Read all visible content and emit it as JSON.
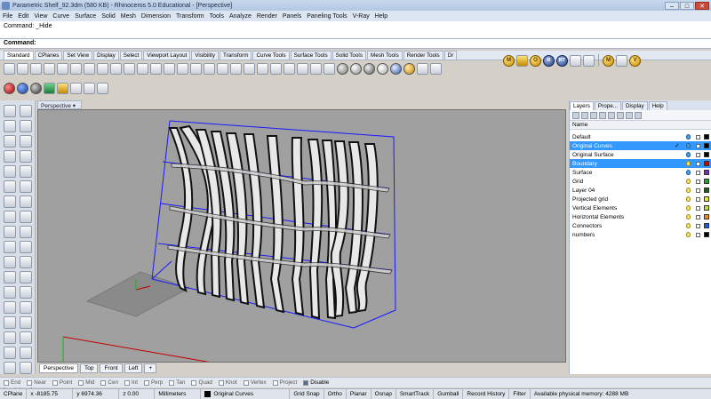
{
  "window": {
    "title": "Parametric Shelf_92.3dm (580 KB) - Rhinoceros 5.0 Educational - [Perspective]",
    "controls": [
      "–",
      "□",
      "✕"
    ]
  },
  "menu": [
    "File",
    "Edit",
    "View",
    "Curve",
    "Surface",
    "Solid",
    "Mesh",
    "Dimension",
    "Transform",
    "Tools",
    "Analyze",
    "Render",
    "Panels",
    "Paneling Tools",
    "V-Ray",
    "Help"
  ],
  "command": {
    "history": "Command: _Hide",
    "prompt": "Command:",
    "value": ""
  },
  "toolbar_tabs": [
    "Standard",
    "CPlanes",
    "Set View",
    "Display",
    "Select",
    "Viewport Layout",
    "Visibility",
    "Transform",
    "Curve Tools",
    "Surface Tools",
    "Solid Tools",
    "Mesh Tools",
    "Render Tools",
    "Dr"
  ],
  "toolbar_tabs_active": "Standard",
  "vray_buttons": [
    {
      "letter": "M",
      "name": "vray-material-editor-icon"
    },
    {
      "letter": "O",
      "name": "vray-options-icon"
    },
    {
      "letter": "R",
      "name": "vray-render-icon"
    },
    {
      "letter": "RT",
      "name": "vray-rt-icon"
    },
    {
      "letter": "M",
      "name": "vray-material-icon"
    },
    {
      "letter": "V",
      "name": "vray-vfb-icon"
    }
  ],
  "viewport": {
    "label": "Perspective",
    "tabs": [
      "Perspective",
      "Top",
      "Front",
      "Left"
    ],
    "active_tab": "Perspective"
  },
  "panel": {
    "tabs": [
      "Layers",
      "Prope...",
      "Display",
      "Help"
    ],
    "active_tab": "Layers",
    "column_header": "Name",
    "layers": [
      {
        "name": "Default",
        "color": "#000000",
        "selected": false,
        "current": false
      },
      {
        "name": "Original Curves",
        "color": "#000000",
        "selected": true,
        "current": true
      },
      {
        "name": "Original Surface",
        "color": "#000000",
        "selected": false,
        "current": false
      },
      {
        "name": "Boundary",
        "color": "#cc0000",
        "selected": true,
        "current": false
      },
      {
        "name": "Surface",
        "color": "#7b2fb5",
        "selected": false,
        "current": false
      },
      {
        "name": "Grid",
        "color": "#2e9c2e",
        "selected": false,
        "current": false
      },
      {
        "name": "Layer 04",
        "color": "#1b5e1b",
        "selected": false,
        "current": false
      },
      {
        "name": "Projected grid",
        "color": "#e8e832",
        "selected": false,
        "current": false
      },
      {
        "name": "Vertical Elements",
        "color": "#b9e235",
        "selected": false,
        "current": false
      },
      {
        "name": "Horizontal Elements",
        "color": "#e88f1a",
        "selected": false,
        "current": false
      },
      {
        "name": "Connectors",
        "color": "#2858d6",
        "selected": false,
        "current": false
      },
      {
        "name": "numbers",
        "color": "#000000",
        "selected": false,
        "current": false
      }
    ]
  },
  "osnap": [
    {
      "label": "End",
      "checked": false
    },
    {
      "label": "Near",
      "checked": false
    },
    {
      "label": "Point",
      "checked": false
    },
    {
      "label": "Mid",
      "checked": false
    },
    {
      "label": "Cen",
      "checked": false
    },
    {
      "label": "Int",
      "checked": false
    },
    {
      "label": "Perp",
      "checked": false
    },
    {
      "label": "Tan",
      "checked": false
    },
    {
      "label": "Quad",
      "checked": false
    },
    {
      "label": "Knot",
      "checked": false
    },
    {
      "label": "Vertex",
      "checked": false
    },
    {
      "label": "Project",
      "checked": false
    },
    {
      "label": "Disable",
      "checked": true
    }
  ],
  "status": {
    "cplane": "CPlane",
    "x": "x -8185.75",
    "y": "y 6974.36",
    "z": "z 0.00",
    "units": "Millimeters",
    "layer": "Original Curves",
    "buttons": [
      "Grid Snap",
      "Ortho",
      "Planar",
      "Osnap",
      "SmartTrack",
      "Gumball",
      "Record History",
      "Filter"
    ],
    "memory": "Available physical memory: 4288 MB"
  },
  "colors": {
    "viewport_bg": "#a0a0a0",
    "selection_blue": "#3399ff",
    "boundary_blue": "#1a1aff",
    "axis_red": "#c00000"
  }
}
